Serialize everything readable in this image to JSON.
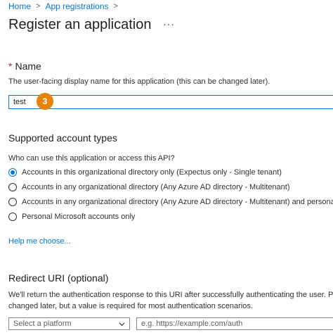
{
  "breadcrumb": {
    "home": "Home",
    "separator": ">",
    "current": "App registrations",
    "trailing_separator": ">"
  },
  "header": {
    "title": "Register an application",
    "more": "···"
  },
  "name_section": {
    "required_mark": "*",
    "label": "Name",
    "help": "The user-facing display name for this application (this can be changed later).",
    "value": "test",
    "step_badge": "3"
  },
  "account_types": {
    "title": "Supported account types",
    "question": "Who can use this application or access this API?",
    "options": [
      {
        "label": "Accounts in this organizational directory only (Expectus only - Single tenant)",
        "selected": true
      },
      {
        "label": "Accounts in any organizational directory (Any Azure AD directory - Multitenant)",
        "selected": false
      },
      {
        "label": "Accounts in any organizational directory (Any Azure AD directory - Multitenant) and personal Mi",
        "selected": false
      },
      {
        "label": "Personal Microsoft accounts only",
        "selected": false
      }
    ],
    "help_link": "Help me choose..."
  },
  "redirect": {
    "title": "Redirect URI (optional)",
    "desc_line1": "We'll return the authentication response to this URI after successfully authenticating the user. Provi",
    "desc_line2": "changed later, but a value is required for most authentication scenarios.",
    "platform_placeholder": "Select a platform",
    "uri_placeholder": "e.g. https://example.com/auth"
  },
  "colors": {
    "accent": "#0078d4",
    "badge": "#e8830a",
    "required": "#a4262c"
  }
}
